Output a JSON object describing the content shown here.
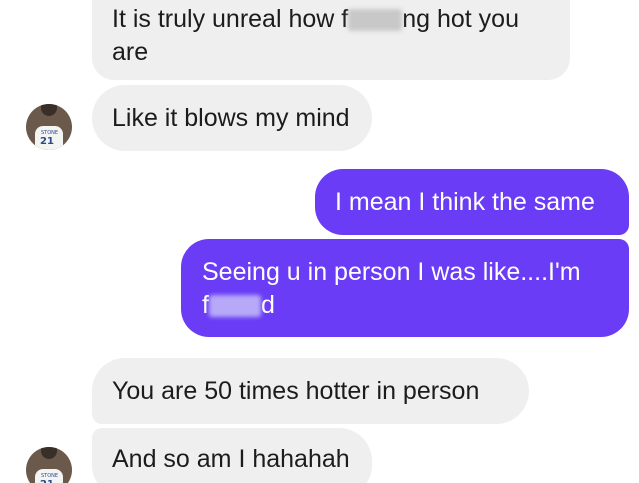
{
  "messages": [
    {
      "id": "m1",
      "direction": "incoming",
      "line1_pre": "It is truly unreal how f",
      "line1_post": "ng hot you",
      "line2": "are"
    },
    {
      "id": "m2",
      "direction": "incoming",
      "text": "Like it blows my mind"
    },
    {
      "id": "m3",
      "direction": "outgoing",
      "text": "I mean I think the same"
    },
    {
      "id": "m4",
      "direction": "outgoing",
      "line1": "Seeing u in person I was like....I'm",
      "line2_pre": "f",
      "line2_post": "d"
    },
    {
      "id": "m5",
      "direction": "incoming",
      "text": "You are 50 times hotter in person"
    },
    {
      "id": "m6",
      "direction": "incoming",
      "text": "And so am I hahahah"
    }
  ],
  "avatar": {
    "jersey_text": "STONE",
    "jersey_number": "21"
  },
  "colors": {
    "incoming_bubble": "#efefef",
    "outgoing_bubble": "#6a3cf6",
    "background": "#ffffff"
  }
}
